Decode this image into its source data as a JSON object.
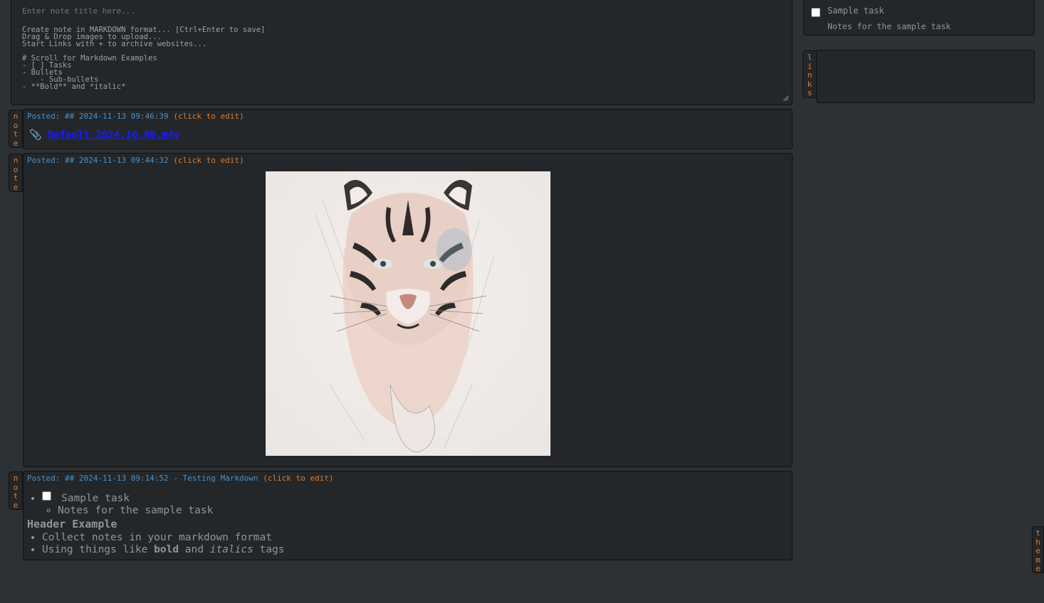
{
  "editor": {
    "title_placeholder": "Enter note title here...",
    "body_placeholder": "Create note in MARKDOWN format... [Ctrl+Enter to save]\nDrag & Drop images to upload...\nStart Links with + to archive websites...\n\n# Scroll for Markdown Examples\n- [ ] Tasks\n- Bullets\n    - Sub-bullets\n- **Bold** and *italic*"
  },
  "tabs": {
    "note": "n\no\nt\ne",
    "links": "l\ni\nn\nk\ns",
    "theme": "t\nh\ne\nm\ne"
  },
  "notes": [
    {
      "posted": "Posted: ## 2024-11-13 09:46:39 ",
      "edit": "(click to edit)",
      "attachment_icon": "paperclip-icon",
      "attachment_glyph": "📎",
      "attachment": "Default 2024.10.00.m4v"
    },
    {
      "posted": "Posted: ## 2024-11-13 09:44:32 ",
      "edit": "(click to edit)",
      "image_icon": "tiger-sketch-image"
    },
    {
      "posted": "Posted: ## 2024-11-13 09:14:52 - Testing Markdown ",
      "edit": "(click to edit)",
      "task": "Sample task",
      "task_note": "Notes for the sample task",
      "header": "Header Example",
      "bullet1": "Collect notes in your markdown format",
      "bullet2_pre": "Using things like ",
      "bullet2_bold": "bold",
      "bullet2_mid": " and ",
      "bullet2_italic": "italics",
      "bullet2_post": " tags"
    }
  ],
  "sidebar": {
    "task": "Sample task",
    "task_note": "Notes for the sample task"
  },
  "colors": {
    "background": "#2d3134",
    "panel": "#23272a",
    "accent_orange": "#e07a2b",
    "timestamp_blue": "#4a90c8",
    "link_blue": "#1a1aff"
  }
}
